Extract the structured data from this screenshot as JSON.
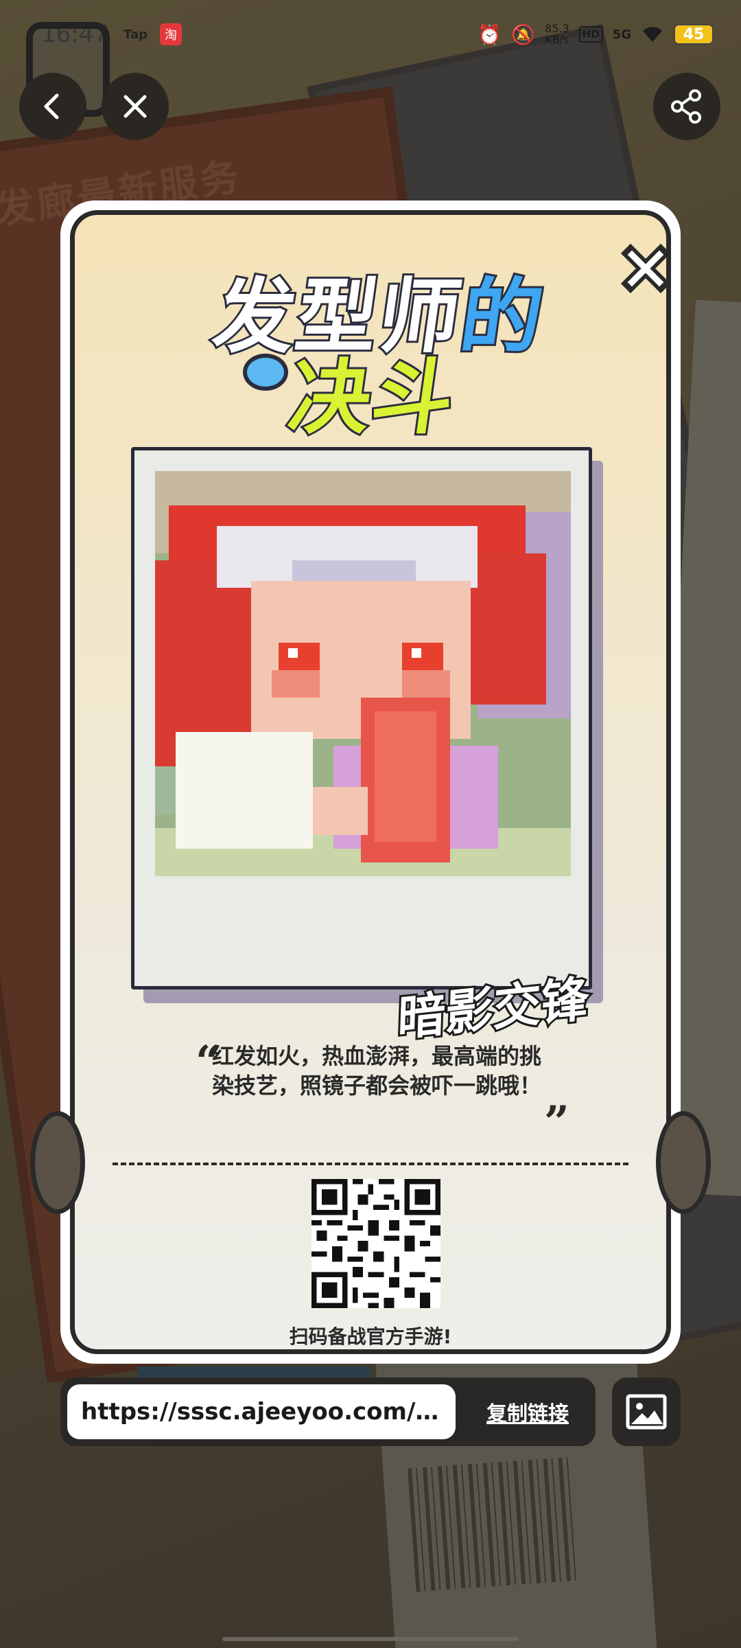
{
  "status_bar": {
    "time": "16:47",
    "app_label": "Tap",
    "taobao_label": "淘",
    "net_speed_value": "85.3",
    "net_speed_unit": "KB/s",
    "hd_label": "HD",
    "network_label": "5G",
    "battery": "45"
  },
  "nav": {
    "back_icon": "chevron-left-icon",
    "close_icon": "close-icon",
    "share_icon": "share-icon"
  },
  "background": {
    "poster_text": "大保发廊最新服务"
  },
  "card": {
    "title_line1_a": "发型师",
    "title_line1_b": "的",
    "title_line2": "决斗",
    "caption_logo": "暗影交锋",
    "quote": "红发如火，热血澎湃，最高端的挑染技艺，照镜子都会被吓一跳哦！",
    "quote_open": "“",
    "quote_close": "”",
    "qr_caption": "扫码备战官方手游!"
  },
  "link_bar": {
    "url": "https://sssc.ajeeyoo.com/h5...",
    "copy_label": "复制链接"
  },
  "colors": {
    "accent_blue": "#3ea6f2",
    "accent_lime": "#d9f233",
    "dark": "#2a2827",
    "card_cream": "#f5e3b8"
  }
}
